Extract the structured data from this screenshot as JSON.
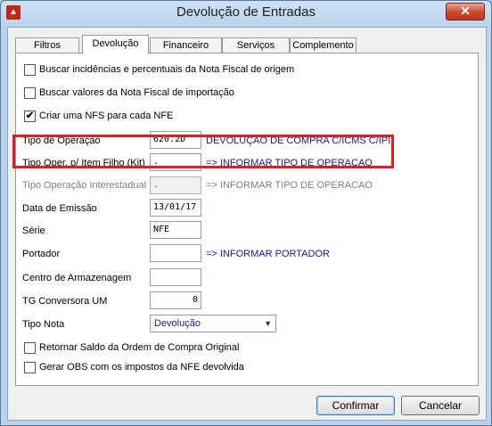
{
  "window": {
    "title": "Devolução de Entradas",
    "close_glyph": "✕",
    "app_icon": "app-logo-icon"
  },
  "tabs": [
    {
      "label": "Filtros",
      "active": false
    },
    {
      "label": "Devolução",
      "active": true
    },
    {
      "label": "Financeiro",
      "active": false
    },
    {
      "label": "Serviços",
      "active": false
    },
    {
      "label": "Complemento",
      "active": false
    }
  ],
  "checkboxes": {
    "incidencias": {
      "label": "Buscar incidências e percentuais da Nota Fiscal de origem",
      "checked": false
    },
    "valores": {
      "label": "Buscar valores da Nota Fiscal de importação",
      "checked": false
    },
    "nfs": {
      "label": "Criar uma NFS para cada NFE",
      "checked": true,
      "mark": "✔"
    },
    "retornar": {
      "label": "Retornar Saldo da Ordem de Compra Original",
      "checked": false
    },
    "gerar_obs": {
      "label": "Gerar OBS com os impostos da NFE devolvida",
      "checked": false
    }
  },
  "fields": {
    "tipo_operacao": {
      "label": "Tipo de Operação",
      "value": "620.2D",
      "note": "DEVOLUÇÃO DE COMPRA C/ICMS C/IPI"
    },
    "tipo_oper_filho": {
      "label": "Tipo Oper. p/ Item Filho (Kit)",
      "value": ".",
      "note": "=> INFORMAR TIPO DE OPERACAO"
    },
    "tipo_interestadual": {
      "label": "Tipo Operação Interestadual",
      "value": ".",
      "note": "=> INFORMAR TIPO DE OPERACAO",
      "disabled": true
    },
    "data_emissao": {
      "label": "Data de Emissão",
      "value": "13/01/17"
    },
    "serie": {
      "label": "Série",
      "value": "NFE"
    },
    "portador": {
      "label": "Portador",
      "value": "",
      "note": "=> INFORMAR PORTADOR"
    },
    "centro_armazenagem": {
      "label": "Centro de Armazenagem",
      "value": ""
    },
    "tg_conversora": {
      "label": "TG Conversora UM",
      "value": "0"
    },
    "tipo_nota": {
      "label": "Tipo Nota",
      "value": "Devolução",
      "arrow": "▼"
    }
  },
  "buttons": {
    "confirm": "Confirmar",
    "cancel": "Cancelar"
  },
  "colors": {
    "highlight": "#e01e26",
    "note_text": "#1a1a8a"
  }
}
